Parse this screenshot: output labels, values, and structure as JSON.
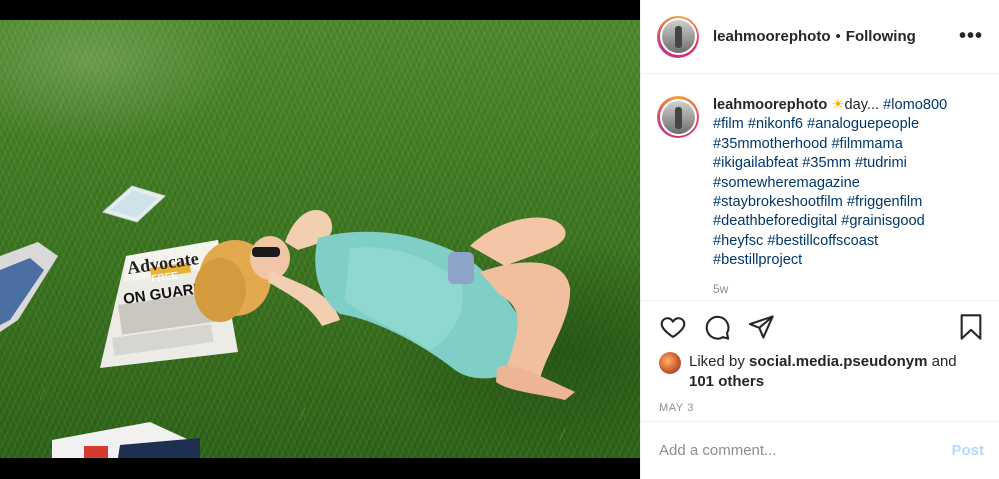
{
  "post": {
    "username": "leahmoorephoto",
    "separator": "•",
    "follow_status": "Following",
    "more_label": "•••"
  },
  "photo": {
    "newspaper_headline": "Advocate",
    "newspaper_sub": "ON GUARD",
    "newspaper_banner": "FREE"
  },
  "caption": {
    "username": "leahmoorephoto",
    "sun_emoji": "☀",
    "text_prefix": "day...",
    "lines": [
      "#lomo800",
      "#film #nikonf6 #analoguepeople",
      "#35mmotherhood #filmmama",
      "#ikigailabfeat #35mm #tudrimi",
      "#somewheremagazine",
      "#staybrokeshootfilm #friggenfilm",
      "#deathbeforedigital #grainisgood",
      "#heyfsc #bestillcoffscoast",
      "#bestillproject"
    ],
    "age": "5w"
  },
  "actions": {
    "like_icon": "heart-icon",
    "comment_icon": "comment-icon",
    "share_icon": "share-icon",
    "save_icon": "bookmark-icon"
  },
  "likes": {
    "prefix": "Liked by",
    "user": "social.media.pseudonym",
    "connector": "and",
    "others": "101 others"
  },
  "date": "MAY 3",
  "comment": {
    "placeholder": "Add a comment...",
    "post_label": "Post"
  },
  "colors": {
    "hashtag": "#00376b",
    "post_disabled": "#b3dbff",
    "muted": "#8e8e8e"
  }
}
